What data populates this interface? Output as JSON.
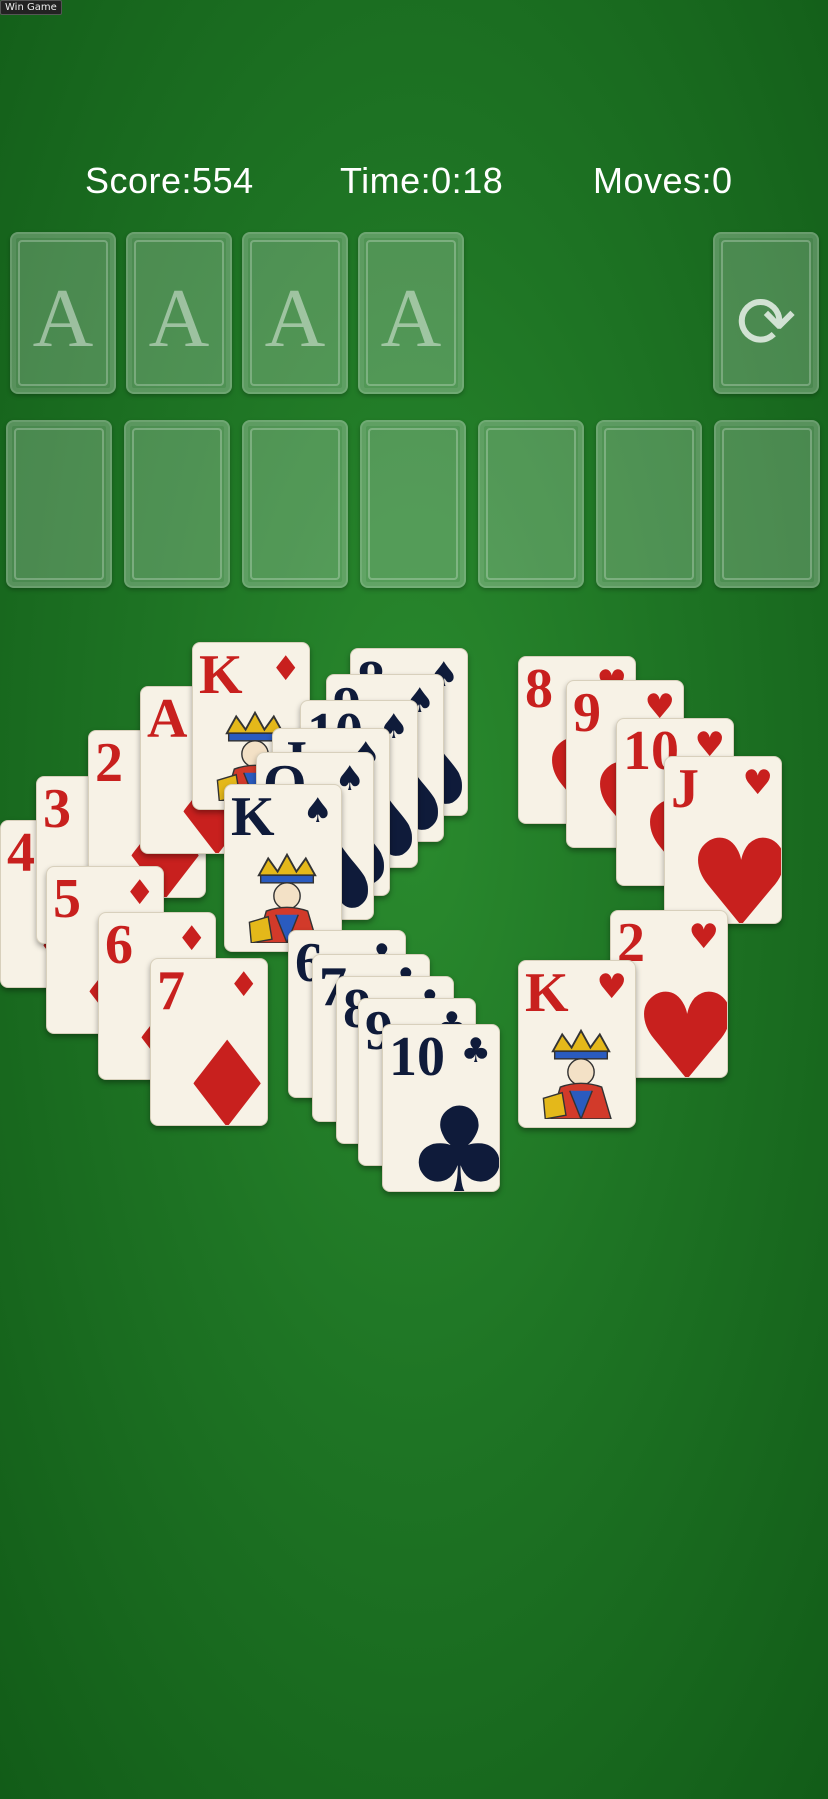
{
  "window_tag": "Win Game",
  "hud": {
    "score": "Score:554",
    "time": "Time:0:18",
    "moves": "Moves:0"
  },
  "foundations": [
    "A",
    "A",
    "A",
    "A"
  ],
  "stock": {
    "icon": "refresh-icon",
    "glyph": "⟳"
  },
  "tableau_count": 7,
  "colors": {
    "felt": "#1e7424",
    "red_suit": "#c8201e",
    "black_suit": "#0f1b3a",
    "card": "#f7f2e6"
  },
  "cards": [
    {
      "rank": "4",
      "suit": "♦",
      "color": "red"
    },
    {
      "rank": "3",
      "suit": "♦",
      "color": "red"
    },
    {
      "rank": "2",
      "suit": "♦",
      "color": "red"
    },
    {
      "rank": "A",
      "suit": "♦",
      "color": "red"
    },
    {
      "rank": "5",
      "suit": "♦",
      "color": "red"
    },
    {
      "rank": "6",
      "suit": "♦",
      "color": "red"
    },
    {
      "rank": "7",
      "suit": "♦",
      "color": "red"
    },
    {
      "rank": "K",
      "suit": "♦",
      "color": "red",
      "face": true
    },
    {
      "rank": "8",
      "suit": "♠",
      "color": "black"
    },
    {
      "rank": "9",
      "suit": "♠",
      "color": "black"
    },
    {
      "rank": "10",
      "suit": "♠",
      "color": "black"
    },
    {
      "rank": "J",
      "suit": "♠",
      "color": "black"
    },
    {
      "rank": "Q",
      "suit": "♠",
      "color": "black"
    },
    {
      "rank": "K",
      "suit": "♠",
      "color": "black",
      "face": true
    },
    {
      "rank": "6",
      "suit": "♣",
      "color": "black"
    },
    {
      "rank": "7",
      "suit": "♣",
      "color": "black"
    },
    {
      "rank": "8",
      "suit": "♣",
      "color": "black"
    },
    {
      "rank": "9",
      "suit": "♣",
      "color": "black"
    },
    {
      "rank": "10",
      "suit": "♣",
      "color": "black"
    },
    {
      "rank": "8",
      "suit": "♥",
      "color": "red"
    },
    {
      "rank": "9",
      "suit": "♥",
      "color": "red"
    },
    {
      "rank": "10",
      "suit": "♥",
      "color": "red"
    },
    {
      "rank": "J",
      "suit": "♥",
      "color": "red"
    },
    {
      "rank": "2",
      "suit": "♥",
      "color": "red"
    },
    {
      "rank": "K",
      "suit": "♥",
      "color": "red",
      "face": true
    }
  ]
}
